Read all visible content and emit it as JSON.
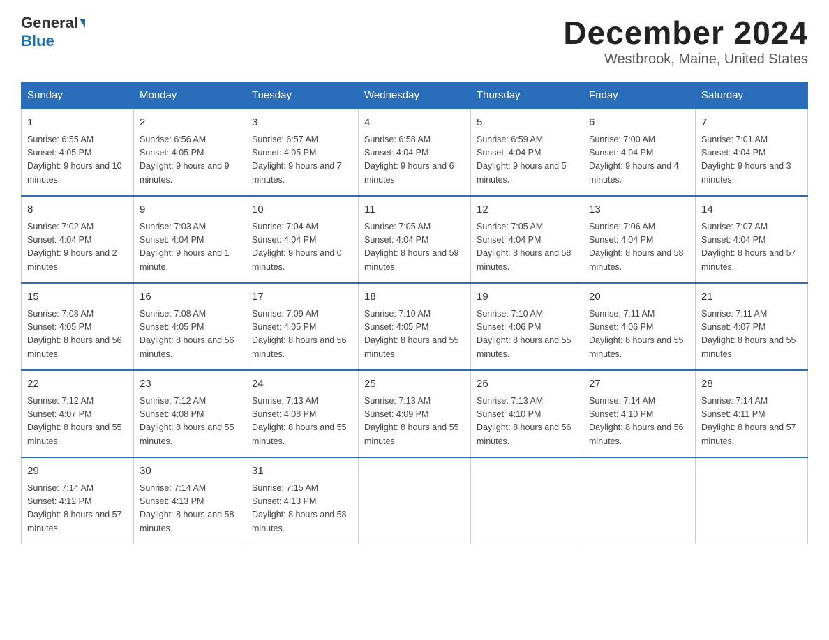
{
  "header": {
    "logo_general": "General",
    "logo_blue": "Blue",
    "title": "December 2024",
    "subtitle": "Westbrook, Maine, United States"
  },
  "days_of_week": [
    "Sunday",
    "Monday",
    "Tuesday",
    "Wednesday",
    "Thursday",
    "Friday",
    "Saturday"
  ],
  "weeks": [
    [
      {
        "day": "1",
        "sunrise": "6:55 AM",
        "sunset": "4:05 PM",
        "daylight": "9 hours and 10 minutes."
      },
      {
        "day": "2",
        "sunrise": "6:56 AM",
        "sunset": "4:05 PM",
        "daylight": "9 hours and 9 minutes."
      },
      {
        "day": "3",
        "sunrise": "6:57 AM",
        "sunset": "4:05 PM",
        "daylight": "9 hours and 7 minutes."
      },
      {
        "day": "4",
        "sunrise": "6:58 AM",
        "sunset": "4:04 PM",
        "daylight": "9 hours and 6 minutes."
      },
      {
        "day": "5",
        "sunrise": "6:59 AM",
        "sunset": "4:04 PM",
        "daylight": "9 hours and 5 minutes."
      },
      {
        "day": "6",
        "sunrise": "7:00 AM",
        "sunset": "4:04 PM",
        "daylight": "9 hours and 4 minutes."
      },
      {
        "day": "7",
        "sunrise": "7:01 AM",
        "sunset": "4:04 PM",
        "daylight": "9 hours and 3 minutes."
      }
    ],
    [
      {
        "day": "8",
        "sunrise": "7:02 AM",
        "sunset": "4:04 PM",
        "daylight": "9 hours and 2 minutes."
      },
      {
        "day": "9",
        "sunrise": "7:03 AM",
        "sunset": "4:04 PM",
        "daylight": "9 hours and 1 minute."
      },
      {
        "day": "10",
        "sunrise": "7:04 AM",
        "sunset": "4:04 PM",
        "daylight": "9 hours and 0 minutes."
      },
      {
        "day": "11",
        "sunrise": "7:05 AM",
        "sunset": "4:04 PM",
        "daylight": "8 hours and 59 minutes."
      },
      {
        "day": "12",
        "sunrise": "7:05 AM",
        "sunset": "4:04 PM",
        "daylight": "8 hours and 58 minutes."
      },
      {
        "day": "13",
        "sunrise": "7:06 AM",
        "sunset": "4:04 PM",
        "daylight": "8 hours and 58 minutes."
      },
      {
        "day": "14",
        "sunrise": "7:07 AM",
        "sunset": "4:04 PM",
        "daylight": "8 hours and 57 minutes."
      }
    ],
    [
      {
        "day": "15",
        "sunrise": "7:08 AM",
        "sunset": "4:05 PM",
        "daylight": "8 hours and 56 minutes."
      },
      {
        "day": "16",
        "sunrise": "7:08 AM",
        "sunset": "4:05 PM",
        "daylight": "8 hours and 56 minutes."
      },
      {
        "day": "17",
        "sunrise": "7:09 AM",
        "sunset": "4:05 PM",
        "daylight": "8 hours and 56 minutes."
      },
      {
        "day": "18",
        "sunrise": "7:10 AM",
        "sunset": "4:05 PM",
        "daylight": "8 hours and 55 minutes."
      },
      {
        "day": "19",
        "sunrise": "7:10 AM",
        "sunset": "4:06 PM",
        "daylight": "8 hours and 55 minutes."
      },
      {
        "day": "20",
        "sunrise": "7:11 AM",
        "sunset": "4:06 PM",
        "daylight": "8 hours and 55 minutes."
      },
      {
        "day": "21",
        "sunrise": "7:11 AM",
        "sunset": "4:07 PM",
        "daylight": "8 hours and 55 minutes."
      }
    ],
    [
      {
        "day": "22",
        "sunrise": "7:12 AM",
        "sunset": "4:07 PM",
        "daylight": "8 hours and 55 minutes."
      },
      {
        "day": "23",
        "sunrise": "7:12 AM",
        "sunset": "4:08 PM",
        "daylight": "8 hours and 55 minutes."
      },
      {
        "day": "24",
        "sunrise": "7:13 AM",
        "sunset": "4:08 PM",
        "daylight": "8 hours and 55 minutes."
      },
      {
        "day": "25",
        "sunrise": "7:13 AM",
        "sunset": "4:09 PM",
        "daylight": "8 hours and 55 minutes."
      },
      {
        "day": "26",
        "sunrise": "7:13 AM",
        "sunset": "4:10 PM",
        "daylight": "8 hours and 56 minutes."
      },
      {
        "day": "27",
        "sunrise": "7:14 AM",
        "sunset": "4:10 PM",
        "daylight": "8 hours and 56 minutes."
      },
      {
        "day": "28",
        "sunrise": "7:14 AM",
        "sunset": "4:11 PM",
        "daylight": "8 hours and 57 minutes."
      }
    ],
    [
      {
        "day": "29",
        "sunrise": "7:14 AM",
        "sunset": "4:12 PM",
        "daylight": "8 hours and 57 minutes."
      },
      {
        "day": "30",
        "sunrise": "7:14 AM",
        "sunset": "4:13 PM",
        "daylight": "8 hours and 58 minutes."
      },
      {
        "day": "31",
        "sunrise": "7:15 AM",
        "sunset": "4:13 PM",
        "daylight": "8 hours and 58 minutes."
      },
      null,
      null,
      null,
      null
    ]
  ]
}
